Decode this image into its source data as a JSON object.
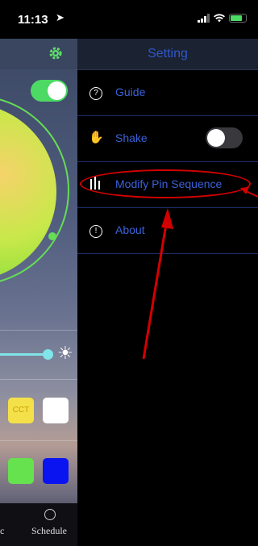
{
  "status_bar": {
    "time": "11:13",
    "location_icon": "location-arrow-icon"
  },
  "background_app": {
    "cct_label": "CCT",
    "tab_left_label": "c",
    "tab_schedule_label": "Schedule",
    "colors": {
      "wheel_arc": "#66dd55",
      "slider": "#7fe5e8",
      "cct": "#f4e14a",
      "green": "#65e24e",
      "blue": "#0a14f0"
    },
    "toggle_on": true
  },
  "settings": {
    "title": "Setting",
    "items": [
      {
        "label": "Guide",
        "icon": "question-circle-icon"
      },
      {
        "label": "Shake",
        "icon": "shake-hand-icon",
        "toggle_on": false
      },
      {
        "label": "Modify Pin Sequence",
        "icon": "pin-sequence-icon"
      },
      {
        "label": "About",
        "icon": "exclamation-circle-icon"
      }
    ]
  },
  "annotation_color": "#d40000",
  "accent": "#3a62d8"
}
